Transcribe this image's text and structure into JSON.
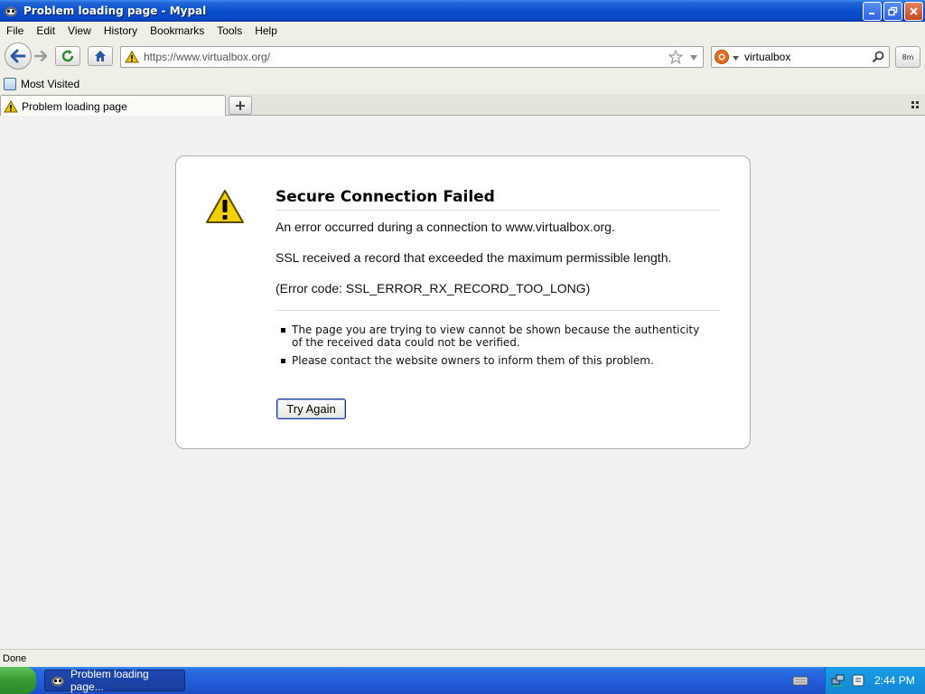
{
  "window": {
    "title": "Problem loading page - Mypal"
  },
  "menu": {
    "items": [
      "File",
      "Edit",
      "View",
      "History",
      "Bookmarks",
      "Tools",
      "Help"
    ]
  },
  "navbar": {
    "url": "https://www.virtualbox.org/",
    "search_value": "virtualbox",
    "addon_label": "8m"
  },
  "bookmarks": {
    "most_visited": "Most Visited"
  },
  "tabs": [
    {
      "label": "Problem loading page"
    }
  ],
  "error": {
    "title": "Secure Connection Failed",
    "line1": "An error occurred during a connection to www.virtualbox.org.",
    "line2": "SSL received a record that exceeded the maximum permissible length.",
    "line3": "(Error code: SSL_ERROR_RX_RECORD_TOO_LONG)",
    "bullets": [
      "The page you are trying to view cannot be shown because the authenticity of the received data could not be verified.",
      "Please contact the website owners to inform them of this problem."
    ],
    "try_again": "Try Again"
  },
  "status": {
    "text": "Done"
  },
  "taskbar": {
    "task_label": "Problem loading page...",
    "clock": "2:44 PM"
  }
}
